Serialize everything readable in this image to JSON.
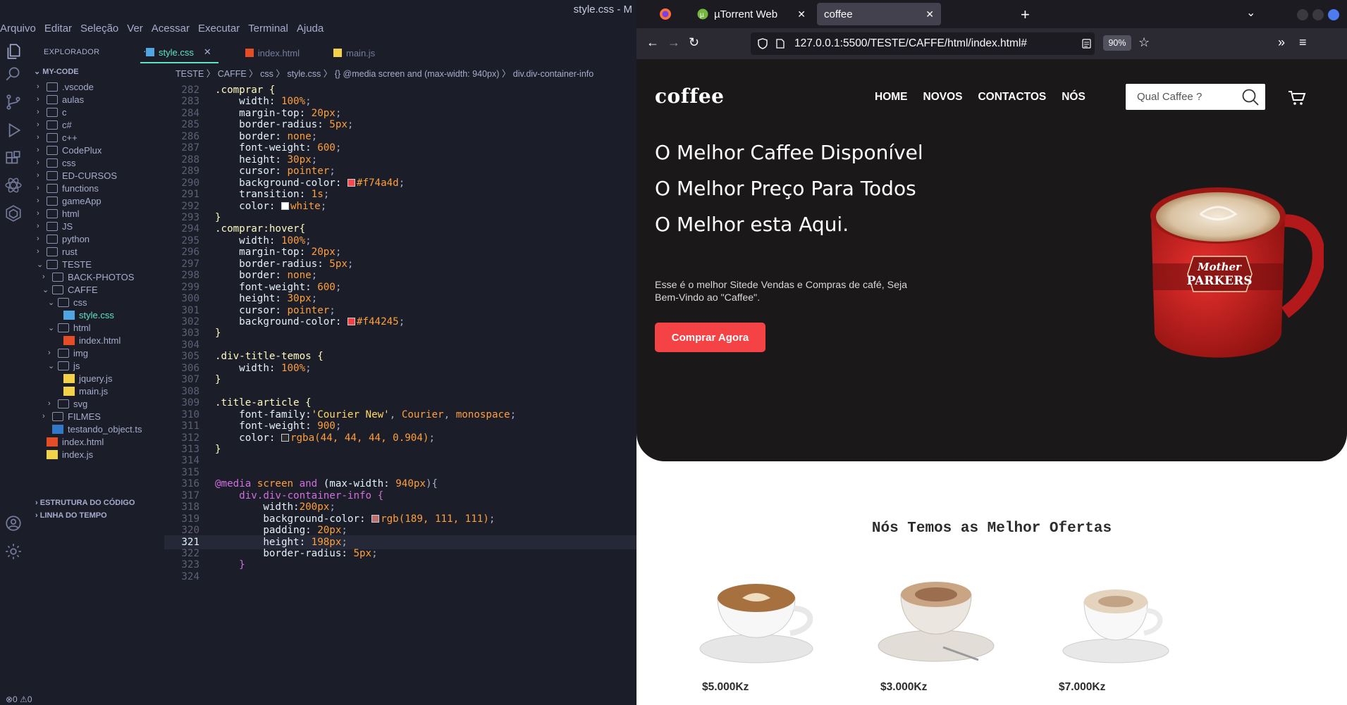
{
  "vscode": {
    "window_title": "style.css - M",
    "menu": [
      "Arquivo",
      "Editar",
      "Seleção",
      "Ver",
      "Acessar",
      "Executar",
      "Terminal",
      "Ajuda"
    ],
    "explorer": {
      "header": "EXPLORADOR",
      "root": "MY-CODE",
      "items": [
        {
          "label": ".vscode",
          "depth": 0,
          "kind": "folder",
          "open": false
        },
        {
          "label": "aulas",
          "depth": 0,
          "kind": "folder",
          "open": false
        },
        {
          "label": "c",
          "depth": 0,
          "kind": "folder",
          "open": false
        },
        {
          "label": "c#",
          "depth": 0,
          "kind": "folder",
          "open": false
        },
        {
          "label": "c++",
          "depth": 0,
          "kind": "folder",
          "open": false
        },
        {
          "label": "CodePlux",
          "depth": 0,
          "kind": "folder",
          "open": false
        },
        {
          "label": "css",
          "depth": 0,
          "kind": "folder",
          "open": false
        },
        {
          "label": "ED-CURSOS",
          "depth": 0,
          "kind": "folder",
          "open": false
        },
        {
          "label": "functions",
          "depth": 0,
          "kind": "folder",
          "open": false
        },
        {
          "label": "gameApp",
          "depth": 0,
          "kind": "folder",
          "open": false
        },
        {
          "label": "html",
          "depth": 0,
          "kind": "folder",
          "open": false
        },
        {
          "label": "JS",
          "depth": 0,
          "kind": "folder",
          "open": false
        },
        {
          "label": "python",
          "depth": 0,
          "kind": "folder",
          "open": false
        },
        {
          "label": "rust",
          "depth": 0,
          "kind": "folder",
          "open": false
        },
        {
          "label": "TESTE",
          "depth": 0,
          "kind": "folder",
          "open": true
        },
        {
          "label": "BACK-PHOTOS",
          "depth": 1,
          "kind": "folder",
          "open": false
        },
        {
          "label": "CAFFE",
          "depth": 1,
          "kind": "folder",
          "open": true
        },
        {
          "label": "css",
          "depth": 2,
          "kind": "folder",
          "open": true
        },
        {
          "label": "style.css",
          "depth": 3,
          "kind": "css",
          "selected": true
        },
        {
          "label": "html",
          "depth": 2,
          "kind": "folder",
          "open": true
        },
        {
          "label": "index.html",
          "depth": 3,
          "kind": "html"
        },
        {
          "label": "img",
          "depth": 2,
          "kind": "folder",
          "open": false
        },
        {
          "label": "js",
          "depth": 2,
          "kind": "folder",
          "open": true
        },
        {
          "label": "jquery.js",
          "depth": 3,
          "kind": "js"
        },
        {
          "label": "main.js",
          "depth": 3,
          "kind": "js"
        },
        {
          "label": "svg",
          "depth": 2,
          "kind": "folder",
          "open": false
        },
        {
          "label": "FILMES",
          "depth": 1,
          "kind": "folder",
          "open": false
        },
        {
          "label": "testando_object.ts",
          "depth": 1,
          "kind": "ts"
        },
        {
          "label": "index.html",
          "depth": 0,
          "kind": "html"
        },
        {
          "label": "index.js",
          "depth": 0,
          "kind": "js"
        }
      ],
      "outline": "ESTRUTURA DO CÓDIGO",
      "timeline": "LINHA DO TEMPO"
    },
    "tabs": [
      {
        "label": "style.css",
        "kind": "css",
        "active": true
      },
      {
        "label": "index.html",
        "kind": "html",
        "active": false
      },
      {
        "label": "main.js",
        "kind": "js",
        "active": false
      }
    ],
    "breadcrumb": "TESTE  〉 CAFFE  〉 css  〉 style.css  〉 {} @media screen and (max-width: 940px)  〉 div.div-container-info",
    "current_line": 321,
    "code": [
      {
        "n": 282,
        "t": [
          [
            ".comprar {",
            "sel"
          ]
        ]
      },
      {
        "n": 283,
        "t": [
          [
            "    width: ",
            "prop"
          ],
          [
            "100%",
            "num"
          ],
          [
            ";",
            "punc"
          ]
        ]
      },
      {
        "n": 284,
        "t": [
          [
            "    margin-top: ",
            "prop"
          ],
          [
            "20px",
            "num"
          ],
          [
            ";",
            "punc"
          ]
        ]
      },
      {
        "n": 285,
        "t": [
          [
            "    border-radius: ",
            "prop"
          ],
          [
            "5px",
            "num"
          ],
          [
            ";",
            "punc"
          ]
        ]
      },
      {
        "n": 286,
        "t": [
          [
            "    border: ",
            "prop"
          ],
          [
            "none",
            "val"
          ],
          [
            ";",
            "punc"
          ]
        ]
      },
      {
        "n": 287,
        "t": [
          [
            "    font-weight: ",
            "prop"
          ],
          [
            "600",
            "num"
          ],
          [
            ";",
            "punc"
          ]
        ]
      },
      {
        "n": 288,
        "t": [
          [
            "    height: ",
            "prop"
          ],
          [
            "30px",
            "num"
          ],
          [
            ";",
            "punc"
          ]
        ]
      },
      {
        "n": 289,
        "t": [
          [
            "    cursor: ",
            "prop"
          ],
          [
            "pointer",
            "val"
          ],
          [
            ";",
            "punc"
          ]
        ]
      },
      {
        "n": 290,
        "t": [
          [
            "    background-color: ",
            "prop"
          ],
          [
            "#f74a4d",
            "swatch"
          ],
          [
            "#f74a4d",
            "val"
          ],
          [
            ";",
            "punc"
          ]
        ]
      },
      {
        "n": 291,
        "t": [
          [
            "    transition: ",
            "prop"
          ],
          [
            "1s",
            "num"
          ],
          [
            ";",
            "punc"
          ]
        ]
      },
      {
        "n": 292,
        "t": [
          [
            "    color: ",
            "prop"
          ],
          [
            "#ffffff",
            "swatch"
          ],
          [
            "white",
            "val"
          ],
          [
            ";",
            "punc"
          ]
        ]
      },
      {
        "n": 293,
        "t": [
          [
            "}",
            "sel"
          ]
        ]
      },
      {
        "n": 294,
        "t": [
          [
            ".comprar:hover{",
            "sel"
          ]
        ]
      },
      {
        "n": 295,
        "t": [
          [
            "    width: ",
            "prop"
          ],
          [
            "100%",
            "num"
          ],
          [
            ";",
            "punc"
          ]
        ]
      },
      {
        "n": 296,
        "t": [
          [
            "    margin-top: ",
            "prop"
          ],
          [
            "20px",
            "num"
          ],
          [
            ";",
            "punc"
          ]
        ]
      },
      {
        "n": 297,
        "t": [
          [
            "    border-radius: ",
            "prop"
          ],
          [
            "5px",
            "num"
          ],
          [
            ";",
            "punc"
          ]
        ]
      },
      {
        "n": 298,
        "t": [
          [
            "    border: ",
            "prop"
          ],
          [
            "none",
            "val"
          ],
          [
            ";",
            "punc"
          ]
        ]
      },
      {
        "n": 299,
        "t": [
          [
            "    font-weight: ",
            "prop"
          ],
          [
            "600",
            "num"
          ],
          [
            ";",
            "punc"
          ]
        ]
      },
      {
        "n": 300,
        "t": [
          [
            "    height: ",
            "prop"
          ],
          [
            "30px",
            "num"
          ],
          [
            ";",
            "punc"
          ]
        ]
      },
      {
        "n": 301,
        "t": [
          [
            "    cursor: ",
            "prop"
          ],
          [
            "pointer",
            "val"
          ],
          [
            ";",
            "punc"
          ]
        ]
      },
      {
        "n": 302,
        "t": [
          [
            "    background-color: ",
            "prop"
          ],
          [
            "#f44245",
            "swatch"
          ],
          [
            "#f44245",
            "val"
          ],
          [
            ";",
            "punc"
          ]
        ]
      },
      {
        "n": 303,
        "t": [
          [
            "}",
            "sel"
          ]
        ]
      },
      {
        "n": 304,
        "t": []
      },
      {
        "n": 305,
        "t": [
          [
            ".div-title-temos {",
            "sel"
          ]
        ]
      },
      {
        "n": 306,
        "t": [
          [
            "    width: ",
            "prop"
          ],
          [
            "100%",
            "num"
          ],
          [
            ";",
            "punc"
          ]
        ]
      },
      {
        "n": 307,
        "t": [
          [
            "}",
            "sel"
          ]
        ]
      },
      {
        "n": 308,
        "t": []
      },
      {
        "n": 309,
        "t": [
          [
            ".title-article {",
            "sel"
          ]
        ]
      },
      {
        "n": 310,
        "t": [
          [
            "    font-family:",
            "prop"
          ],
          [
            "'Courier New'",
            "str"
          ],
          [
            ", ",
            "punc"
          ],
          [
            "Courier",
            "val"
          ],
          [
            ", ",
            "punc"
          ],
          [
            "monospace",
            "val"
          ],
          [
            ";",
            "punc"
          ]
        ]
      },
      {
        "n": 311,
        "t": [
          [
            "    font-weight: ",
            "prop"
          ],
          [
            "900",
            "num"
          ],
          [
            ";",
            "punc"
          ]
        ]
      },
      {
        "n": 312,
        "t": [
          [
            "    color: ",
            "prop"
          ],
          [
            "#2c2c2c",
            "swatch"
          ],
          [
            "rgba(44, 44, 44, 0.904)",
            "val"
          ],
          [
            ";",
            "punc"
          ]
        ]
      },
      {
        "n": 313,
        "t": [
          [
            "}",
            "sel"
          ]
        ]
      },
      {
        "n": 314,
        "t": []
      },
      {
        "n": 315,
        "t": []
      },
      {
        "n": 316,
        "t": [
          [
            "@media ",
            "at"
          ],
          [
            "screen ",
            "val"
          ],
          [
            "and ",
            "at"
          ],
          [
            "(max-width: ",
            "prop"
          ],
          [
            "940px",
            "num"
          ],
          [
            "){",
            "punc"
          ]
        ]
      },
      {
        "n": 317,
        "t": [
          [
            "    div.div-container-info {",
            "at"
          ]
        ]
      },
      {
        "n": 318,
        "t": [
          [
            "        width:",
            "prop"
          ],
          [
            "200px",
            "num"
          ],
          [
            ";",
            "punc"
          ]
        ]
      },
      {
        "n": 319,
        "t": [
          [
            "        background-color: ",
            "prop"
          ],
          [
            "#bd6f6f",
            "swatch"
          ],
          [
            "rgb(189, 111, 111)",
            "val"
          ],
          [
            ";",
            "punc"
          ]
        ]
      },
      {
        "n": 320,
        "t": [
          [
            "        padding: ",
            "prop"
          ],
          [
            "20px",
            "num"
          ],
          [
            ";",
            "punc"
          ]
        ]
      },
      {
        "n": 321,
        "t": [
          [
            "        height: ",
            "prop"
          ],
          [
            "198px",
            "num"
          ],
          [
            ";",
            "punc"
          ]
        ]
      },
      {
        "n": 322,
        "t": [
          [
            "        border-radius: ",
            "prop"
          ],
          [
            "5px",
            "num"
          ],
          [
            ";",
            "punc"
          ]
        ]
      },
      {
        "n": 323,
        "t": [
          [
            "    }",
            "at"
          ]
        ]
      },
      {
        "n": 324,
        "t": []
      }
    ],
    "status": "⊗0 ⚠0"
  },
  "firefox": {
    "tabs": [
      {
        "label": "",
        "icon": "firefox-icon"
      },
      {
        "label": "µTorrent Web",
        "icon": "utorrent-icon"
      },
      {
        "label": "coffee",
        "active": true
      }
    ],
    "url": "127.0.0.1:5500/TESTE/CAFFE/html/index.html#",
    "zoom": "90%",
    "site": {
      "logo": "coffee",
      "nav": [
        "HOME",
        "NOVOS",
        "CONTACTOS",
        "NÓS"
      ],
      "search_placeholder": "Qual Caffee ?",
      "hero_lines": [
        "O Melhor Caffee Disponível",
        "O Melhor Preço Para Todos",
        "O Melhor esta Aqui."
      ],
      "hero_sub": "Esse é o melhor Sitede Vendas e Compras de café, Seja Bem-Vindo ao \"Caffee\".",
      "cta": "Comprar Agora",
      "mug_brand_1": "Mother",
      "mug_brand_2": "PARKERS",
      "offers_title": "Nós Temos as Melhor Ofertas",
      "offers": [
        {
          "price": "$5.000Kz"
        },
        {
          "price": "$3.000Kz"
        },
        {
          "price": "$7.000Kz"
        }
      ]
    }
  }
}
